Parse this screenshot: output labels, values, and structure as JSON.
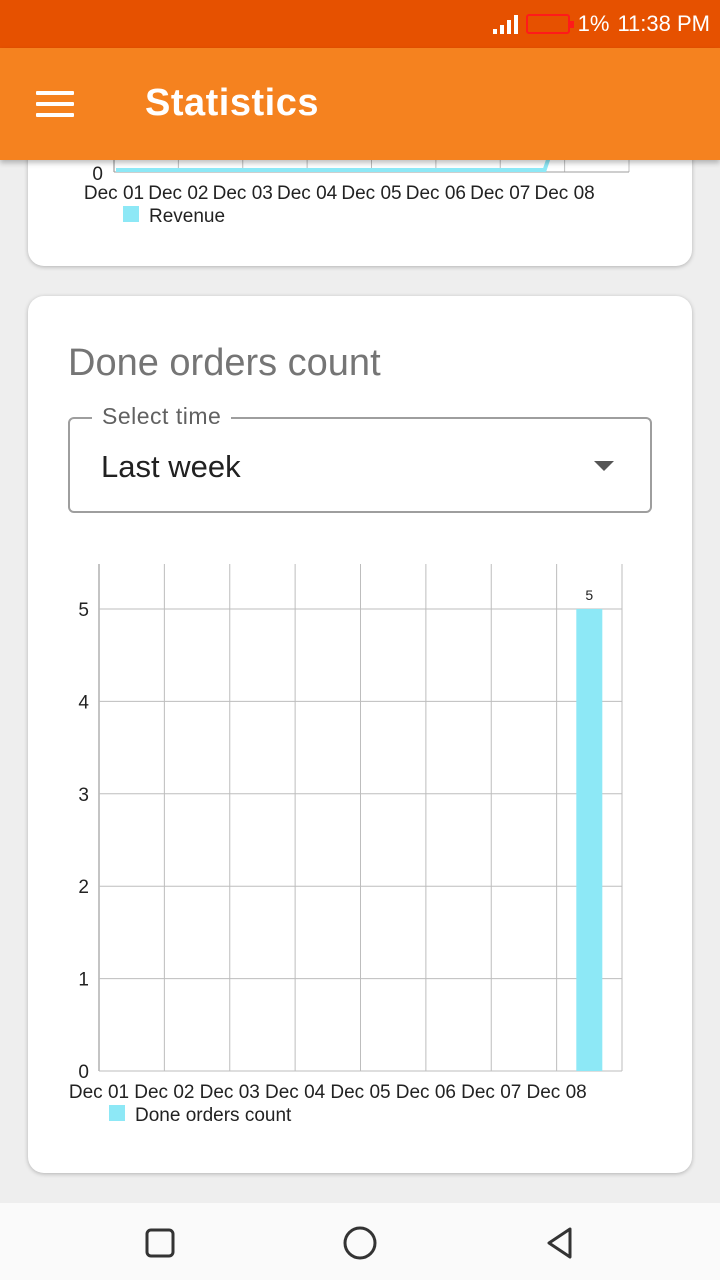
{
  "status_bar": {
    "battery": "1%",
    "time": "11:38 PM"
  },
  "app_bar": {
    "title": "Statistics",
    "menu_icon": "hamburger-menu-icon"
  },
  "revenue_card": {
    "chart_data": {
      "type": "line",
      "categories": [
        "Dec 01",
        "Dec 02",
        "Dec 03",
        "Dec 04",
        "Dec 05",
        "Dec 06",
        "Dec 07",
        "Dec 08"
      ],
      "y_tick_visible": "0",
      "series": [
        {
          "name": "Revenue",
          "color": "#8de8f6"
        }
      ],
      "legend": "bottom-left"
    }
  },
  "done_orders_card": {
    "title": "Done orders count",
    "select": {
      "label": "Select time",
      "value": "Last week"
    },
    "chart_data": {
      "type": "bar",
      "categories": [
        "Dec 01",
        "Dec 02",
        "Dec 03",
        "Dec 04",
        "Dec 05",
        "Dec 06",
        "Dec 07",
        "Dec 08"
      ],
      "series": [
        {
          "name": "Done orders count",
          "values": [
            0,
            0,
            0,
            0,
            0,
            0,
            0,
            5
          ],
          "color": "#8de8f6"
        }
      ],
      "ylim": [
        0,
        5
      ],
      "yticks": [
        "0",
        "1",
        "2",
        "3",
        "4",
        "5"
      ],
      "data_labels": [
        "",
        "",
        "",
        "",
        "",
        "",
        "",
        "5"
      ],
      "grid": true,
      "legend": "bottom-left"
    }
  },
  "nav_bar": {
    "icons": [
      "recent-apps-icon",
      "home-icon",
      "back-icon"
    ]
  }
}
